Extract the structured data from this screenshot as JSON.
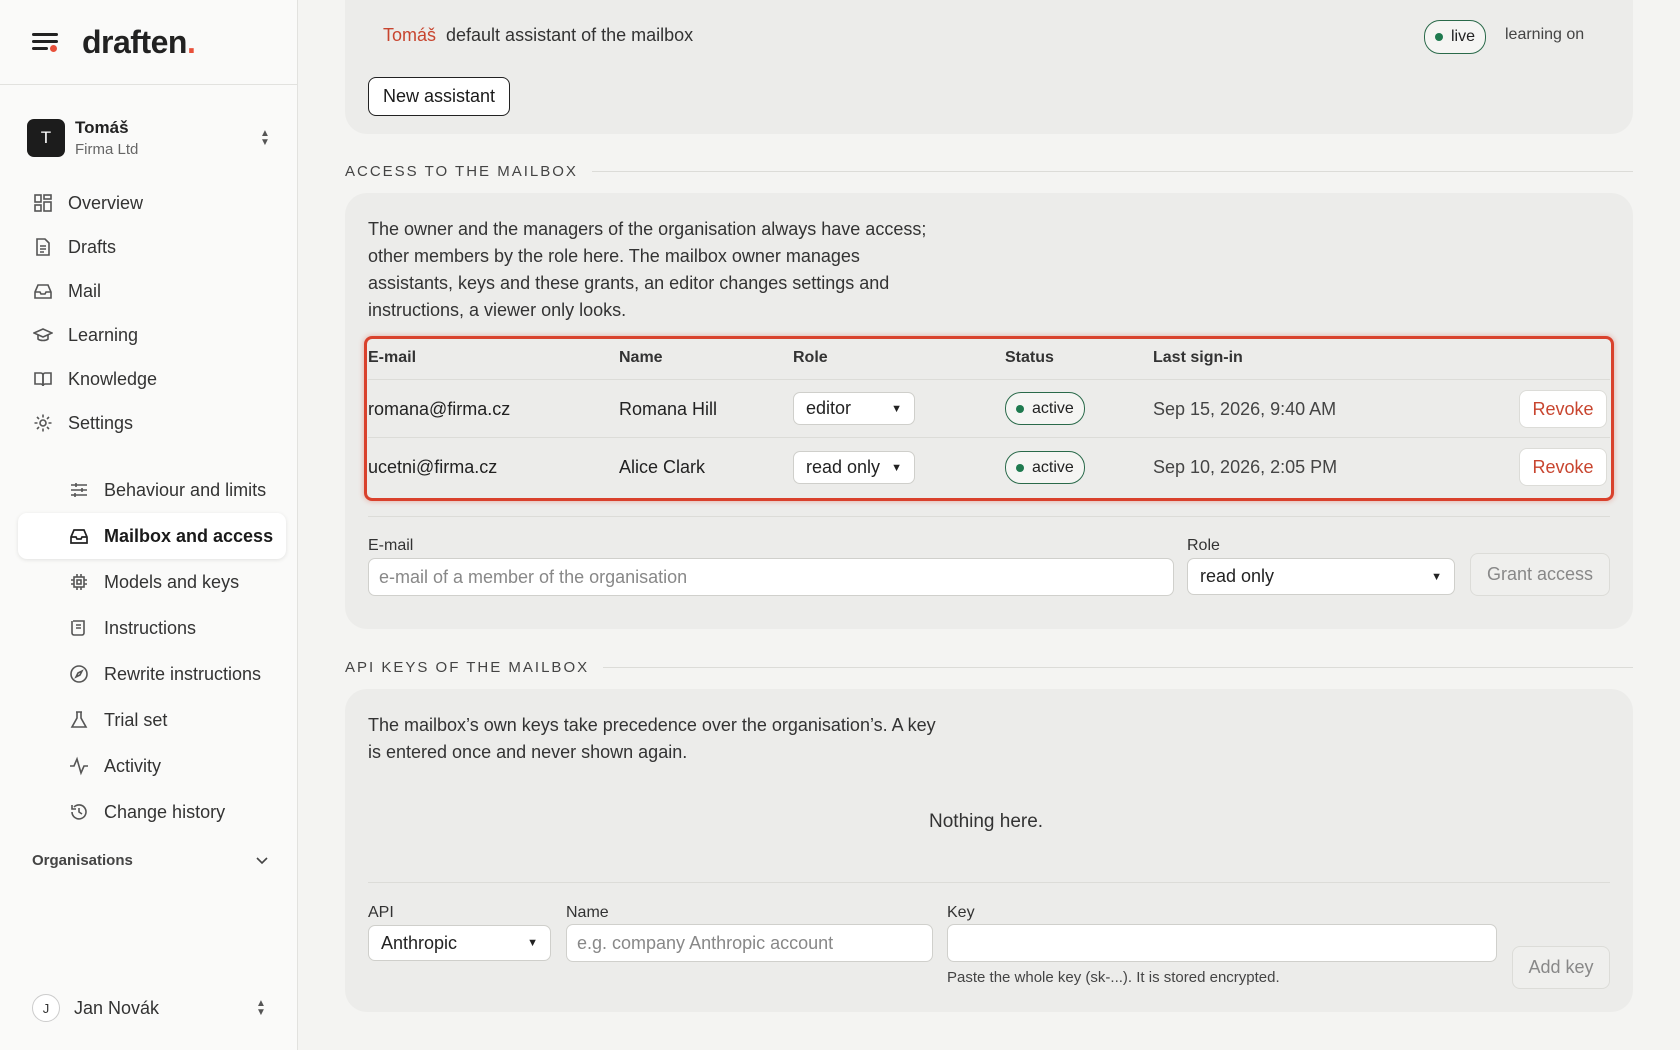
{
  "brand": {
    "name": "draften",
    "dot": "."
  },
  "account": {
    "initial": "T",
    "name": "Tomáš",
    "org": "Firma Ltd"
  },
  "nav": {
    "overview": "Overview",
    "drafts": "Drafts",
    "mail": "Mail",
    "learning": "Learning",
    "knowledge": "Knowledge",
    "settings": "Settings",
    "behaviour": "Behaviour and limits",
    "mailbox": "Mailbox and access",
    "models": "Models and keys",
    "instructions": "Instructions",
    "rewrite": "Rewrite instructions",
    "trial": "Trial set",
    "activity": "Activity",
    "history": "Change history"
  },
  "organisations_label": "Organisations",
  "user": {
    "initial": "J",
    "name": "Jan Novák"
  },
  "assistant": {
    "name": "Tomáš",
    "description": "default assistant of the mailbox",
    "status": "live",
    "learning": "learning on",
    "new_button": "New assistant"
  },
  "access": {
    "title": "ACCESS TO THE MAILBOX",
    "text": [
      "The owner and the managers of the organisation always have access;",
      "other members by the role here. The mailbox owner manages",
      "assistants, keys and these grants, an editor changes settings and",
      "instructions, a viewer only looks."
    ],
    "columns": {
      "email": "E-mail",
      "name": "Name",
      "role": "Role",
      "status": "Status",
      "last": "Last sign-in"
    },
    "rows": [
      {
        "email": "romana@firma.cz",
        "name": "Romana Hill",
        "role": "editor",
        "status": "active",
        "last": "Sep 15, 2026, 9:40 AM",
        "action": "Revoke"
      },
      {
        "email": "ucetni@firma.cz",
        "name": "Alice Clark",
        "role": "read only",
        "status": "active",
        "last": "Sep 10, 2026, 2:05 PM",
        "action": "Revoke"
      }
    ],
    "form": {
      "email_label": "E-mail",
      "email_placeholder": "e-mail of a member of the organisation",
      "role_label": "Role",
      "role_value": "read only",
      "grant_button": "Grant access"
    }
  },
  "api": {
    "title": "API KEYS OF THE MAILBOX",
    "text": [
      "The mailbox’s own keys take precedence over the organisation’s. A key",
      "is entered once and never shown again."
    ],
    "empty": "Nothing here.",
    "form": {
      "api_label": "API",
      "api_value": "Anthropic",
      "name_label": "Name",
      "name_placeholder": "e.g. company Anthropic account",
      "key_label": "Key",
      "key_hint": "Paste the whole key (sk-...). It is stored encrypted.",
      "add_button": "Add key"
    }
  },
  "colors": {
    "accent": "#c8452f",
    "highlight": "#d9412c",
    "status_green": "#1f7a4f"
  }
}
